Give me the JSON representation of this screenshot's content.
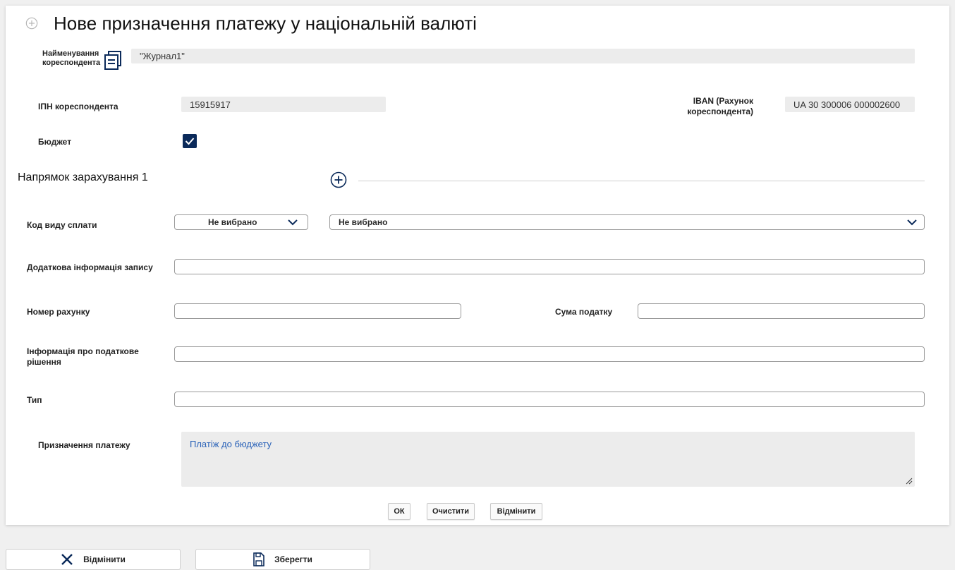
{
  "dialog": {
    "title": "Нове призначення платежу у національній валюті"
  },
  "correspondent": {
    "name_label_line1": "Найменування",
    "name_label_line2": "кореспондента",
    "name_value": "\"Журнал1\"",
    "ipn_label": "ІПН кореспондента",
    "ipn_value": "15915917",
    "iban_label_line1": "IBAN (Рахунок",
    "iban_label_line2": "кореспондента)",
    "iban_value": "UA 30 300006 000002600"
  },
  "budget": {
    "label": "Бюджет",
    "checked": true
  },
  "direction": {
    "title": "Напрямок зарахування 1"
  },
  "fields": {
    "payment_type_label": "Код виду сплати",
    "payment_type_select1": "Не вибрано",
    "payment_type_select2": "Не вибрано",
    "additional_info_label": "Додаткова інформація запису",
    "additional_info_value": "",
    "account_number_label": "Номер рахунку",
    "account_number_value": "",
    "tax_amount_label": "Сума податку",
    "tax_amount_value": "",
    "tax_decision_label_line1": "Інформація про податкове",
    "tax_decision_label_line2": "рішення",
    "tax_decision_value": "",
    "type_label": "Тип",
    "type_value": "",
    "purpose_label": "Призначення платежу",
    "purpose_value": "Платіж до бюджету"
  },
  "dialog_buttons": {
    "ok": "ОК",
    "clear": "Очистити",
    "cancel": "Відмінити"
  },
  "footer_buttons": {
    "cancel": "Відмінити",
    "save": "Зберегти"
  },
  "icons": {
    "title": "plus-circle-icon",
    "name_lookup": "list-icon",
    "add_direction": "plus-circle-icon",
    "chevron": "chevron-down-icon",
    "cancel": "close-icon",
    "save": "save-icon",
    "resize": "resize-handle-icon"
  },
  "colors": {
    "checkbox": "#0b2a5a",
    "purpose_text": "#2a62b8",
    "accent_icon": "#0b2a5a"
  }
}
